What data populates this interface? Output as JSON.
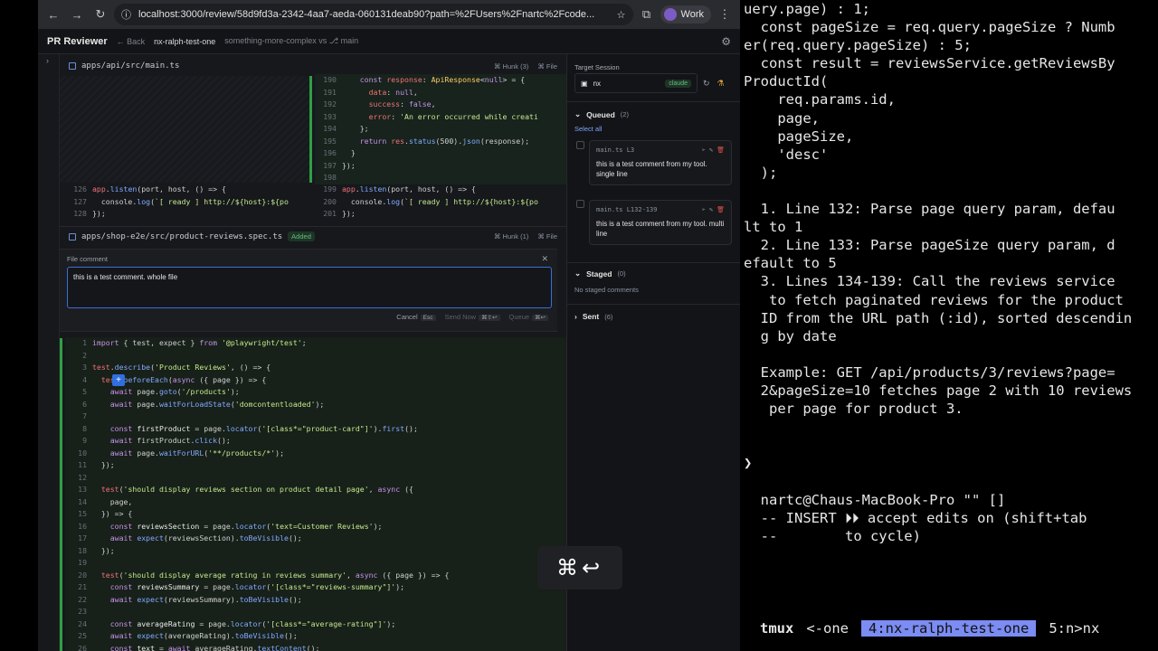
{
  "browser": {
    "url": "localhost:3000/review/58d9fd3a-2342-4aa7-aeda-060131deab90?path=%2FUsers%2Fnartc%2Fcode...",
    "profile": "Work"
  },
  "app": {
    "brand": "PR Reviewer",
    "back": "← Back",
    "branch": "nx-ralph-test-one",
    "compare": "something-more-complex vs ⎇ main"
  },
  "files": [
    {
      "path": "apps/api/src/main.ts",
      "hunk": "Hunk (3)",
      "file": "File"
    },
    {
      "path": "apps/shop-e2e/src/product-reviews.spec.ts",
      "badge": "Added",
      "hunk": "Hunk (1)",
      "file": "File"
    }
  ],
  "comment_box": {
    "label": "File comment",
    "value": "this is a test comment. whole file",
    "cancel": "Cancel",
    "cancel_key": "Esc",
    "send": "Send Now",
    "send_key": "⌘⇧↩",
    "queue": "Queue",
    "queue_key": "⌘↩"
  },
  "sidebar": {
    "target_label": "Target Session",
    "session": "nx",
    "session_tag": "claude",
    "queued": {
      "title": "Queued",
      "count": "(2)",
      "select_all": "Select all"
    },
    "cards": [
      {
        "loc": "main.ts L3",
        "text": "this is a test comment from my tool. single line"
      },
      {
        "loc": "main.ts L132-139",
        "text": "this is a test comment from my tool. multi line"
      }
    ],
    "staged": {
      "title": "Staged",
      "count": "(0)",
      "empty": "No staged comments"
    },
    "sent": {
      "title": "Sent",
      "count": "(6)"
    }
  },
  "keyboard_overlay": "⌘↩",
  "terminal": {
    "lines": [
      "uery.page) : 1;",
      "  const pageSize = req.query.pageSize ? Numb",
      "er(req.query.pageSize) : 5;",
      "  const result = reviewsService.getReviewsBy",
      "ProductId(",
      "    req.params.id,",
      "    page,",
      "    pageSize,",
      "    'desc'",
      "  );",
      "",
      "  1. Line 132: Parse page query param, defau",
      "lt to 1",
      "  2. Line 133: Parse pageSize query param, d",
      "efault to 5",
      "  3. Lines 134-139: Call the reviews service",
      "   to fetch paginated reviews for the product",
      "  ID from the URL path (:id), sorted descendin",
      "  g by date",
      "",
      "  Example: GET /api/products/3/reviews?page=",
      "  2&pageSize=10 fetches page 2 with 10 reviews",
      "   per page for product 3.",
      "",
      "",
      "❯",
      "",
      "  nartc@Chaus-MacBook-Pro \"\" []",
      "  -- INSERT ⏵⏵ accept edits on (shift+tab",
      "  --        to cycle)"
    ],
    "tmux": {
      "label": "tmux",
      "prev": "<-one",
      "active": "4:nx-ralph-test-one",
      "next": "5:n>nx"
    }
  }
}
